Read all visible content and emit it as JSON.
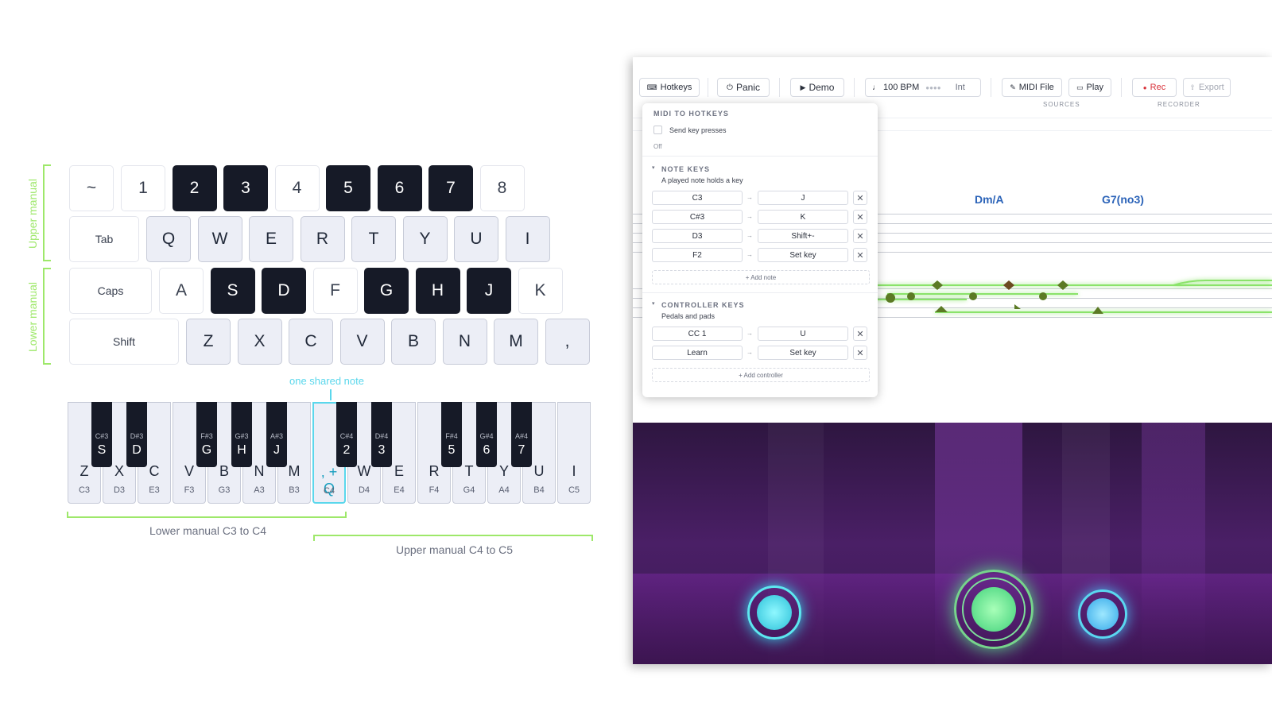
{
  "keyboard": {
    "upper_label": "Upper manual",
    "lower_label": "Lower manual",
    "rows": [
      [
        {
          "l": "~",
          "s": "plain"
        },
        {
          "l": "1",
          "s": "plain"
        },
        {
          "l": "2",
          "s": "dark"
        },
        {
          "l": "3",
          "s": "dark"
        },
        {
          "l": "4",
          "s": "plain"
        },
        {
          "l": "5",
          "s": "dark"
        },
        {
          "l": "6",
          "s": "dark"
        },
        {
          "l": "7",
          "s": "dark"
        },
        {
          "l": "8",
          "s": "plain"
        }
      ],
      [
        {
          "l": "Tab",
          "s": "mod"
        },
        {
          "l": "Q",
          "s": "light"
        },
        {
          "l": "W",
          "s": "light"
        },
        {
          "l": "E",
          "s": "light"
        },
        {
          "l": "R",
          "s": "light"
        },
        {
          "l": "T",
          "s": "light"
        },
        {
          "l": "Y",
          "s": "light"
        },
        {
          "l": "U",
          "s": "light"
        },
        {
          "l": "I",
          "s": "light"
        }
      ],
      [
        {
          "l": "Caps",
          "s": "mod"
        },
        {
          "l": "A",
          "s": "plain"
        },
        {
          "l": "S",
          "s": "dark"
        },
        {
          "l": "D",
          "s": "dark"
        },
        {
          "l": "F",
          "s": "plain"
        },
        {
          "l": "G",
          "s": "dark"
        },
        {
          "l": "H",
          "s": "dark"
        },
        {
          "l": "J",
          "s": "dark"
        },
        {
          "l": "K",
          "s": "plain"
        }
      ],
      [
        {
          "l": "Shift",
          "s": "mod"
        },
        {
          "l": "Z",
          "s": "light"
        },
        {
          "l": "X",
          "s": "light"
        },
        {
          "l": "C",
          "s": "light"
        },
        {
          "l": "V",
          "s": "light"
        },
        {
          "l": "B",
          "s": "light"
        },
        {
          "l": "N",
          "s": "light"
        },
        {
          "l": "M",
          "s": "light"
        },
        {
          "l": ",",
          "s": "light"
        }
      ]
    ]
  },
  "piano": {
    "shared_label": "one shared note",
    "lower_range_label": "Lower manual C3 to C4",
    "upper_range_label": "Upper manual C4 to C5",
    "white_keys": [
      {
        "letter": "Z",
        "note": "C3"
      },
      {
        "letter": "X",
        "note": "D3"
      },
      {
        "letter": "C",
        "note": "E3"
      },
      {
        "letter": "V",
        "note": "F3"
      },
      {
        "letter": "B",
        "note": "G3"
      },
      {
        "letter": "N",
        "note": "A3"
      },
      {
        "letter": "M",
        "note": "B3"
      },
      {
        "letter": ", + Q",
        "note": "C4",
        "shared": true
      },
      {
        "letter": "W",
        "note": "D4"
      },
      {
        "letter": "E",
        "note": "E4"
      },
      {
        "letter": "R",
        "note": "F4"
      },
      {
        "letter": "T",
        "note": "G4"
      },
      {
        "letter": "Y",
        "note": "A4"
      },
      {
        "letter": "U",
        "note": "B4"
      },
      {
        "letter": "I",
        "note": "C5"
      }
    ],
    "black_keys": [
      {
        "letter": "S",
        "note": "C#3",
        "after": 0
      },
      {
        "letter": "D",
        "note": "D#3",
        "after": 1
      },
      {
        "letter": "G",
        "note": "F#3",
        "after": 3
      },
      {
        "letter": "H",
        "note": "G#3",
        "after": 4
      },
      {
        "letter": "J",
        "note": "A#3",
        "after": 5
      },
      {
        "letter": "2",
        "note": "C#4",
        "after": 7
      },
      {
        "letter": "3",
        "note": "D#4",
        "after": 8
      },
      {
        "letter": "5",
        "note": "F#4",
        "after": 10
      },
      {
        "letter": "6",
        "note": "G#4",
        "after": 11
      },
      {
        "letter": "7",
        "note": "A#4",
        "after": 12
      }
    ]
  },
  "toolbar": {
    "hotkeys": "Hotkeys",
    "panic": "Panic",
    "demo": "Demo",
    "bpm": "100 BPM",
    "int": "Int",
    "midi_file": "MIDI File",
    "play": "Play",
    "rec": "Rec",
    "export": "Export",
    "sources_caption": "SOURCES",
    "recorder_caption": "RECORDER"
  },
  "score": {
    "chords": [
      "Dm/A",
      "G7(no3)"
    ]
  },
  "popup": {
    "midi_heading": "MIDI TO HOTKEYS",
    "send_label": "Send key presses",
    "send_state": "Off",
    "note_heading": "NOTE KEYS",
    "note_desc": "A played note holds a key",
    "note_rows": [
      {
        "from": "C3",
        "to": "J"
      },
      {
        "from": "C#3",
        "to": "K"
      },
      {
        "from": "D3",
        "to": "Shift+-"
      },
      {
        "from": "F2",
        "to": "Set key"
      }
    ],
    "add_note": "+ Add note",
    "ctrl_heading": "CONTROLLER KEYS",
    "ctrl_desc": "Pedals and pads",
    "ctrl_rows": [
      {
        "from": "CC 1",
        "to": "U"
      },
      {
        "from": "Learn",
        "to": "Set key"
      }
    ],
    "add_controller": "+ Add controller",
    "arrow": "→",
    "close": "✕"
  },
  "colors": {
    "accent_green": "#9ee86a",
    "accent_cyan": "#5ad7ec",
    "rec_red": "#d8323a",
    "chord_blue": "#2b63b8"
  }
}
